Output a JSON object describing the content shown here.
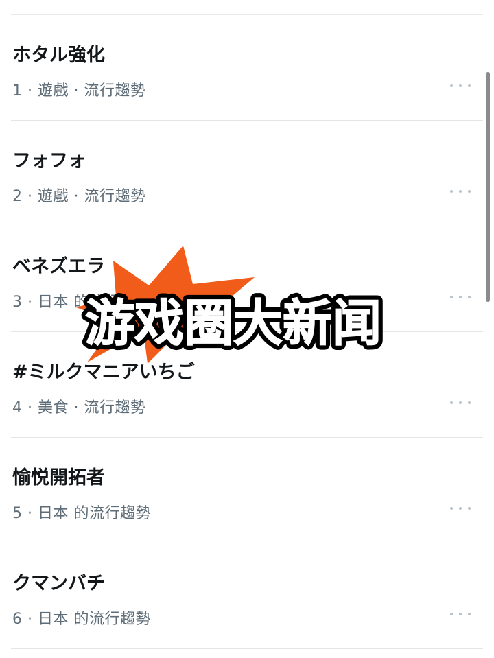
{
  "trends": [
    {
      "title": "ホタル強化",
      "meta": "1 · 遊戲 · 流行趨勢"
    },
    {
      "title": "フォフォ",
      "meta": "2 · 遊戲 · 流行趨勢"
    },
    {
      "title": "ベネズエラ",
      "meta": "3 · 日本 的流行趨勢"
    },
    {
      "title": "#ミルクマニアいちご",
      "meta": "4 · 美食 · 流行趨勢"
    },
    {
      "title": "愉悦開拓者",
      "meta": "5 · 日本 的流行趨勢"
    },
    {
      "title": "クマンバチ",
      "meta": "6 · 日本 的流行趨勢"
    }
  ],
  "overlay": {
    "headline": "游戏圈大新闻"
  },
  "colors": {
    "burst": "#f25c1b",
    "title": "#14171a",
    "meta": "#5e6d78",
    "divider": "#e3e6e9"
  }
}
